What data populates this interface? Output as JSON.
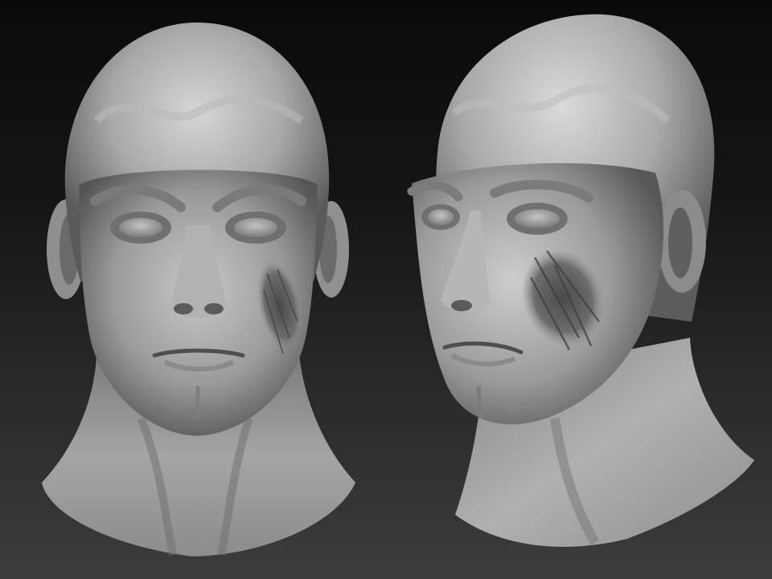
{
  "scene": {
    "background_top": "#0a0a0a",
    "background_bottom": "#3c3c3c",
    "clay_light": "#cfcfcf",
    "clay_mid": "#8a8a8a",
    "clay_dark": "#3a3a3a"
  },
  "views": [
    {
      "view": "front"
    },
    {
      "view": "three-quarter"
    }
  ]
}
